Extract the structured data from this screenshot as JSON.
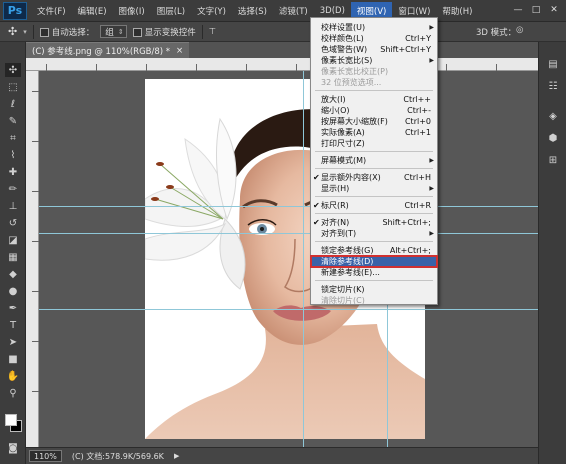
{
  "menubar": {
    "logo": "Ps",
    "items": [
      "文件(F)",
      "编辑(E)",
      "图像(I)",
      "图层(L)",
      "文字(Y)",
      "选择(S)",
      "滤镜(T)",
      "3D(D)",
      "视图(V)",
      "窗口(W)",
      "帮助(H)"
    ],
    "active_index": 8,
    "minimize": "—",
    "restore": "□",
    "close": "✕"
  },
  "options": {
    "auto_select": "自动选择：",
    "group_value": "组",
    "show_transform": "显示变换控件",
    "mode_3d": "3D 模式："
  },
  "document": {
    "tab_title": "(C) 参考线.png @ 110%(RGB/8) *",
    "tab_close": "×"
  },
  "status": {
    "zoom": "110%",
    "doc_info": "(C) 文档:578.9K/569.6K"
  },
  "view_menu": {
    "items": [
      {
        "label": "校样设置(U)",
        "shortcut": "",
        "submenu": true,
        "checked": false,
        "disabled": false
      },
      {
        "label": "校样颜色(L)",
        "shortcut": "Ctrl+Y",
        "submenu": false,
        "checked": false,
        "disabled": false
      },
      {
        "label": "色域警告(W)",
        "shortcut": "Shift+Ctrl+Y",
        "submenu": false,
        "checked": false,
        "disabled": false
      },
      {
        "label": "像素长宽比(S)",
        "shortcut": "",
        "submenu": true,
        "checked": false,
        "disabled": false
      },
      {
        "label": "像素长宽比校正(P)",
        "shortcut": "",
        "submenu": false,
        "checked": false,
        "disabled": true
      },
      {
        "label": "32 位预览选项...",
        "shortcut": "",
        "submenu": false,
        "checked": false,
        "disabled": true
      },
      {
        "label": "放大(I)",
        "shortcut": "Ctrl++",
        "submenu": false,
        "checked": false,
        "disabled": false
      },
      {
        "label": "缩小(O)",
        "shortcut": "Ctrl+-",
        "submenu": false,
        "checked": false,
        "disabled": false
      },
      {
        "label": "按屏幕大小缩放(F)",
        "shortcut": "Ctrl+0",
        "submenu": false,
        "checked": false,
        "disabled": false
      },
      {
        "label": "实际像素(A)",
        "shortcut": "Ctrl+1",
        "submenu": false,
        "checked": false,
        "disabled": false
      },
      {
        "label": "打印尺寸(Z)",
        "shortcut": "",
        "submenu": false,
        "checked": false,
        "disabled": false
      },
      {
        "label": "屏幕模式(M)",
        "shortcut": "",
        "submenu": true,
        "checked": false,
        "disabled": false
      },
      {
        "label": "显示额外内容(X)",
        "shortcut": "Ctrl+H",
        "submenu": false,
        "checked": true,
        "disabled": false
      },
      {
        "label": "显示(H)",
        "shortcut": "",
        "submenu": true,
        "checked": false,
        "disabled": false
      },
      {
        "label": "标尺(R)",
        "shortcut": "Ctrl+R",
        "submenu": false,
        "checked": true,
        "disabled": false
      },
      {
        "label": "对齐(N)",
        "shortcut": "Shift+Ctrl+;",
        "submenu": false,
        "checked": true,
        "disabled": false
      },
      {
        "label": "对齐到(T)",
        "shortcut": "",
        "submenu": true,
        "checked": false,
        "disabled": false
      },
      {
        "label": "锁定参考线(G)",
        "shortcut": "Alt+Ctrl+;",
        "submenu": false,
        "checked": false,
        "disabled": false
      },
      {
        "label": "清除参考线(D)",
        "shortcut": "",
        "submenu": false,
        "checked": false,
        "disabled": false,
        "highlighted": true
      },
      {
        "label": "新建参考线(E)...",
        "shortcut": "",
        "submenu": false,
        "checked": false,
        "disabled": false
      },
      {
        "label": "锁定切片(K)",
        "shortcut": "",
        "submenu": false,
        "checked": false,
        "disabled": false
      },
      {
        "label": "清除切片(C)",
        "shortcut": "",
        "submenu": false,
        "checked": false,
        "disabled": true
      }
    ],
    "check_glyph": "✔",
    "submenu_glyph": "▶"
  }
}
